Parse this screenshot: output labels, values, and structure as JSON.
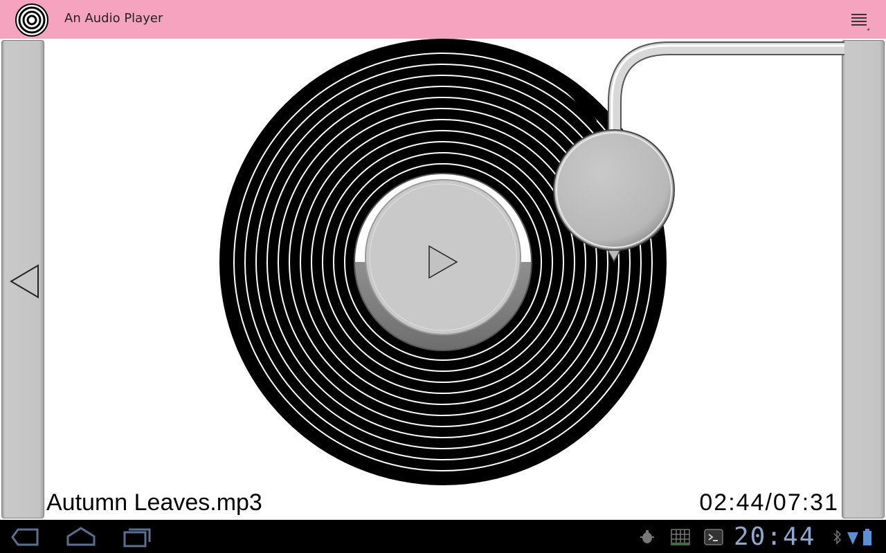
{
  "app": {
    "title": "An Audio Player",
    "icon": "vinyl-record-icon",
    "menu_icon": "overflow-menu-icon"
  },
  "player": {
    "song_title": "Autumn Leaves.mp3",
    "time_readout": "02:44/07:31",
    "elapsed": "02:44",
    "duration": "07:31",
    "center_button_icon": "play-icon",
    "prev_icon": "previous-track-icon"
  },
  "system_bar": {
    "clock": "20:44",
    "nav_icons": [
      "back-icon",
      "home-icon",
      "recent-apps-icon"
    ],
    "notification_icons": [
      "debug-icon",
      "grid-icon",
      "terminal-icon",
      "bluetooth-icon",
      "wifi-icon",
      "battery-icon"
    ]
  },
  "colors": {
    "action_bar": "#f5a3bf",
    "clock": "#8ea8cf",
    "record": "#000000"
  }
}
